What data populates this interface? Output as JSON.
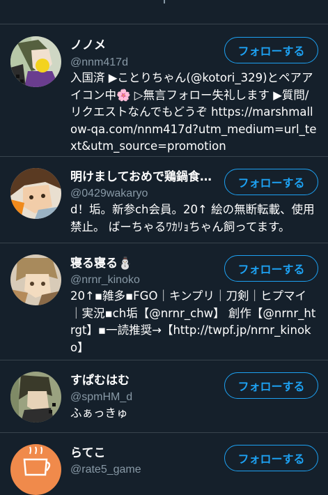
{
  "follow_label": "フォローする",
  "users": [
    {
      "name": "ノノメ",
      "handle": "@nnm417d",
      "bio": "入国済 ▶ことりちゃん(@kotori_329)とペアアイコン中🌸 ▷無言フォロー失礼します ▶質問/リクエストなんでもどうぞ https://marshmallow-qa.com/nnm417d?utm_medium=url_text&utm_source=promotion",
      "avatar_icon": "anime-character-avatar"
    },
    {
      "name": "明けましておめで鶏鍋食べ...",
      "handle": "@0429wakaryo",
      "bio": "d！垢。新参ch会員。20↑ 絵の無断転載、使用禁止。 ばーちゃるﾜｶﾘｮちゃん飼ってます。",
      "avatar_icon": "anime-character-avatar"
    },
    {
      "name": "寝る寝る⛄",
      "handle": "@nrnr_kinoko",
      "bio": "20↑▪雑多▪FGO｜キンプリ｜刀剣｜ヒプマイ｜実況▪ch垢【@nrnr_chw】 創作【@nrnr_htrgt】▪一読推奨→【http://twpf.jp/nrnr_kinoko】",
      "avatar_icon": "anime-character-avatar"
    },
    {
      "name": "すぱむはむ",
      "handle": "@spmHM_d",
      "bio": "ふぁっきゅ",
      "avatar_icon": "anime-character-avatar"
    },
    {
      "name": "らてこ",
      "handle": "@rate5_game",
      "bio": "",
      "avatar_icon": "coffee-cup-avatar"
    }
  ]
}
